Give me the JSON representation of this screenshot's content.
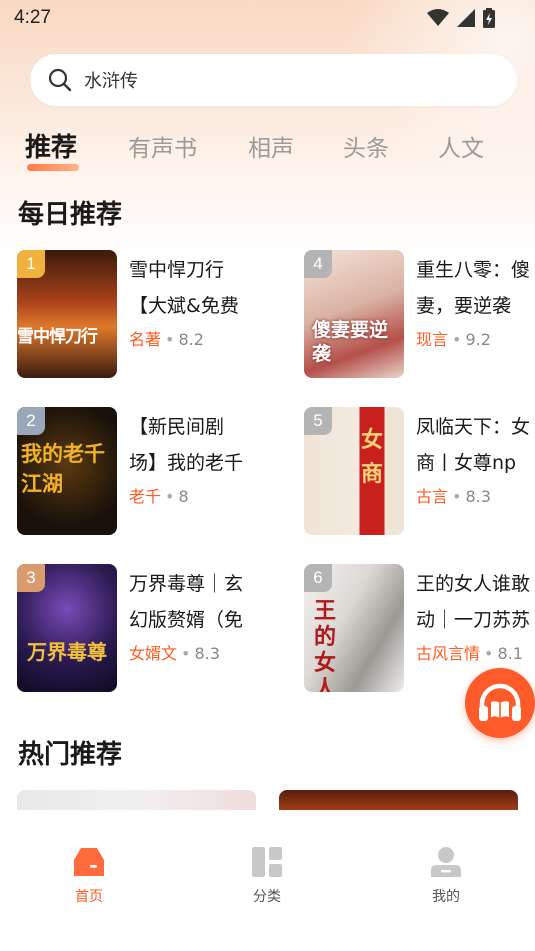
{
  "status": {
    "time": "4:27"
  },
  "search": {
    "query": "水浒传"
  },
  "tabs": [
    {
      "label": "推荐",
      "active": true
    },
    {
      "label": "有声书"
    },
    {
      "label": "相声"
    },
    {
      "label": "头条"
    },
    {
      "label": "人文"
    }
  ],
  "daily": {
    "title": "每日推荐",
    "books": [
      {
        "rank": "1",
        "title_line1": "雪中悍刀行",
        "title_line2": "【大斌&免费",
        "tag": "名著",
        "score": "8.2",
        "cover_text": "雪中悍刀行"
      },
      {
        "rank": "2",
        "title_line1": "【新民间剧",
        "title_line2": "场】我的老千",
        "tag": "老千",
        "score": "8",
        "cover_text": "我的老千江湖"
      },
      {
        "rank": "3",
        "title_line1": "万界毒尊｜玄",
        "title_line2": "幻版赘婿（免",
        "tag": "女婿文",
        "score": "8.3",
        "cover_text": "万界毒尊"
      },
      {
        "rank": "4",
        "title_line1": "重生八零：傻",
        "title_line2": "妻，要逆袭",
        "tag": "现言",
        "score": "9.2",
        "cover_text": "傻妻要逆袭"
      },
      {
        "rank": "5",
        "title_line1": "凤临天下：女",
        "title_line2": "商丨女尊np",
        "tag": "古言",
        "score": "8.3",
        "cover_text": "女商"
      },
      {
        "rank": "6",
        "title_line1": "王的女人谁敢",
        "title_line2": "动｜一刀苏苏",
        "tag": "古风言情",
        "score": "8.1",
        "cover_text": "王的女人"
      }
    ]
  },
  "hot": {
    "title": "热门推荐"
  },
  "nav": [
    {
      "label": "首页",
      "icon": "home-icon",
      "active": true
    },
    {
      "label": "分类",
      "icon": "category-icon"
    },
    {
      "label": "我的",
      "icon": "profile-icon"
    }
  ],
  "colors": {
    "accent": "#ff5a1f",
    "fab": "#ff5a2a"
  }
}
